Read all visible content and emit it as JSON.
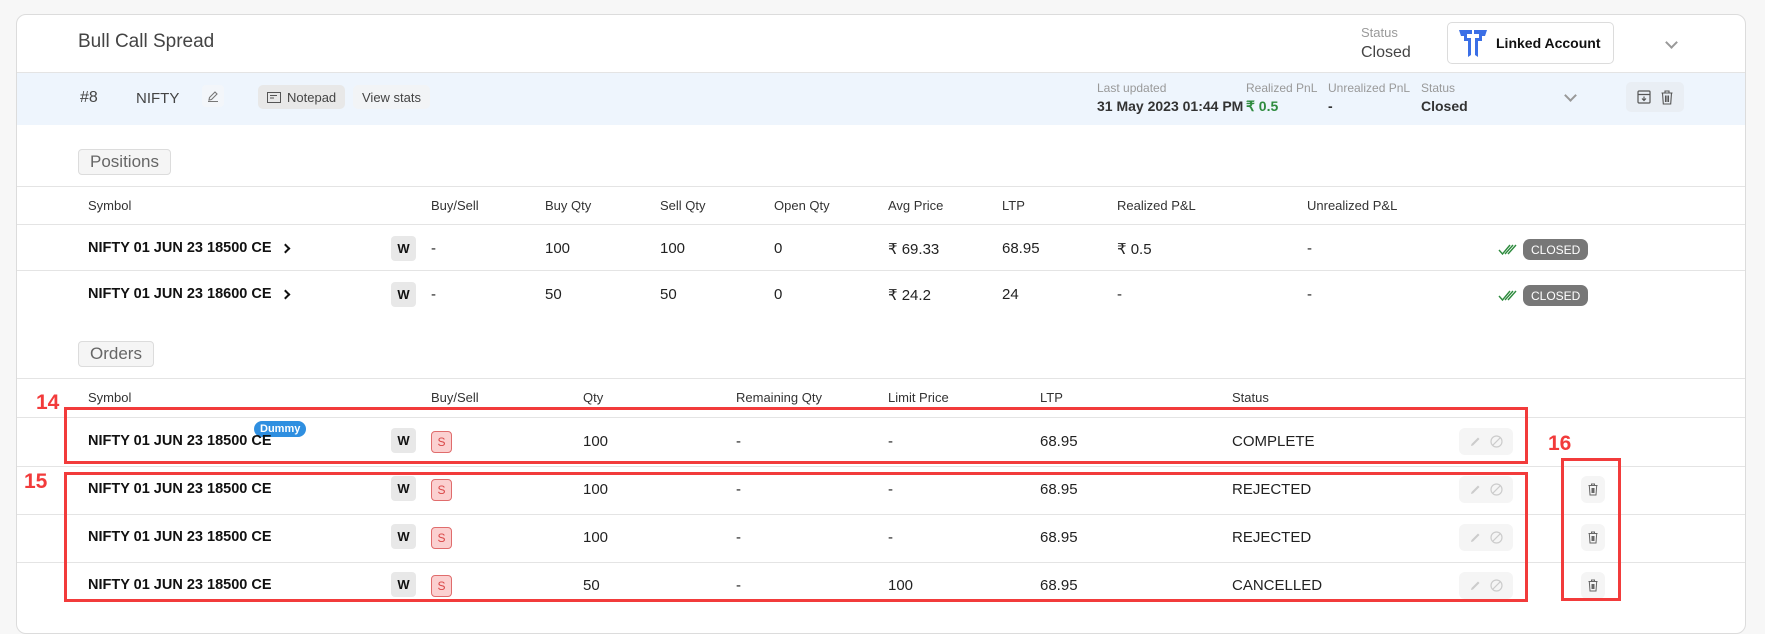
{
  "header": {
    "title": "Bull Call Spread",
    "status_label": "Status",
    "status_value": "Closed",
    "linked_account_label": "Linked Account",
    "brand_color": "#3b6fe6"
  },
  "strategy_bar": {
    "number": "#8",
    "symbol": "NIFTY",
    "notepad_label": "Notepad",
    "view_stats_label": "View stats",
    "last_updated_label": "Last updated",
    "last_updated_value": "31 May 2023 01:44 PM",
    "realized_label": "Realized PnL",
    "realized_value": "₹ 0.5",
    "unrealized_label": "Unrealized PnL",
    "unrealized_value": "-",
    "status_label": "Status",
    "status_value": "Closed"
  },
  "positions": {
    "section_label": "Positions",
    "columns": [
      "Symbol",
      "Buy/Sell",
      "Buy Qty",
      "Sell Qty",
      "Open Qty",
      "Avg Price",
      "LTP",
      "Realized P&L",
      "Unrealized P&L"
    ],
    "rows": [
      {
        "symbol": "NIFTY 01 JUN 23 18500 CE",
        "badge": "W",
        "buy_sell": "-",
        "buy_qty": "100",
        "sell_qty": "100",
        "open_qty": "0",
        "avg_price": "₹ 69.33",
        "ltp": "68.95",
        "realized": "₹ 0.5",
        "unrealized": "-",
        "status": "CLOSED"
      },
      {
        "symbol": "NIFTY 01 JUN 23 18600 CE",
        "badge": "W",
        "buy_sell": "-",
        "buy_qty": "50",
        "sell_qty": "50",
        "open_qty": "0",
        "avg_price": "₹ 24.2",
        "ltp": "24",
        "realized": "-",
        "unrealized": "-",
        "status": "CLOSED"
      }
    ]
  },
  "orders": {
    "section_label": "Orders",
    "columns": [
      "Symbol",
      "Buy/Sell",
      "Qty",
      "Remaining Qty",
      "Limit Price",
      "LTP",
      "Status"
    ],
    "rows": [
      {
        "symbol": "NIFTY 01 JUN 23 18500 CE",
        "tag": "Dummy",
        "badge": "W",
        "side": "S",
        "qty": "100",
        "remaining": "-",
        "limit": "-",
        "ltp": "68.95",
        "status": "COMPLETE"
      },
      {
        "symbol": "NIFTY 01 JUN 23 18500 CE",
        "badge": "W",
        "side": "S",
        "qty": "100",
        "remaining": "-",
        "limit": "-",
        "ltp": "68.95",
        "status": "REJECTED"
      },
      {
        "symbol": "NIFTY 01 JUN 23 18500 CE",
        "badge": "W",
        "side": "S",
        "qty": "100",
        "remaining": "-",
        "limit": "-",
        "ltp": "68.95",
        "status": "REJECTED"
      },
      {
        "symbol": "NIFTY 01 JUN 23 18500 CE",
        "badge": "W",
        "side": "S",
        "qty": "50",
        "remaining": "-",
        "limit": "100",
        "ltp": "68.95",
        "status": "CANCELLED"
      }
    ]
  },
  "annotations": {
    "box_14": "14",
    "box_15": "15",
    "box_16": "16",
    "color": "#f23b3b"
  }
}
